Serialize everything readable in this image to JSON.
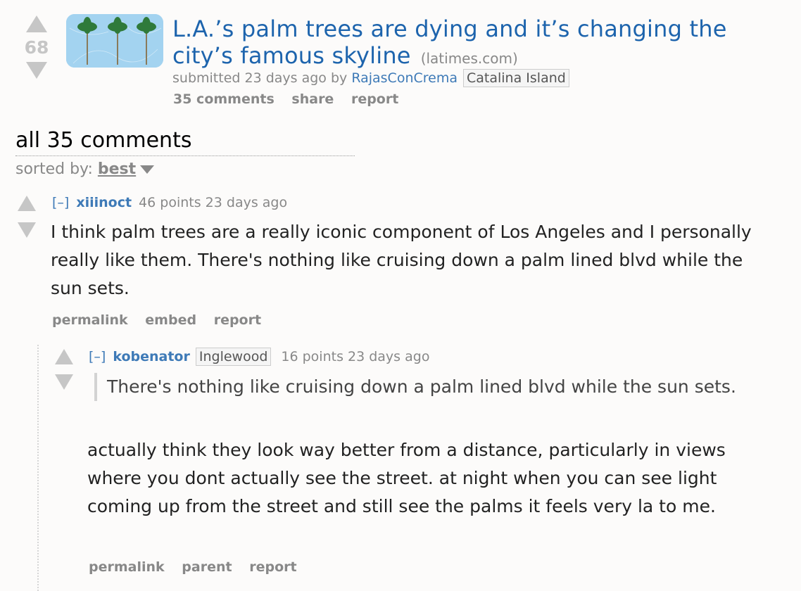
{
  "post": {
    "score": "68",
    "title": "L.A.’s palm trees are dying and it’s changing the city’s famous skyline",
    "domain": "(latimes.com)",
    "submitted_prefix": "submitted 23 days ago by",
    "author": "RajasConCrema",
    "author_flair": "Catalina Island",
    "buttons": {
      "comments": "35 comments",
      "share": "share",
      "report": "report"
    },
    "thumbnail_icon": "palm-trees-thumbnail"
  },
  "comments_area": {
    "title": "all 35 comments",
    "sorted_label": "sorted by:",
    "sort_value": "best"
  },
  "comments": [
    {
      "expand": "[–]",
      "author": "xiiinoct",
      "points": "46 points",
      "age": "23 days ago",
      "body": "I think palm trees are a really iconic component of Los Angeles and I personally really like them. There's nothing like cruising down a palm lined blvd while the sun sets.",
      "buttons": {
        "permalink": "permalink",
        "embed": "embed",
        "report": "report"
      }
    },
    {
      "expand": "[–]",
      "author": "kobenator",
      "flair": "Inglewood",
      "points": "16 points",
      "age": "23 days ago",
      "quote": "There's nothing like cruising down a palm lined blvd while the sun sets.",
      "body": "actually think they look way better from a distance, particularly in views where you dont actually see the street. at night when you can see light coming up from the street and still see the palms it feels very la to me.",
      "buttons": {
        "permalink": "permalink",
        "parent": "parent",
        "report": "report"
      }
    }
  ]
}
